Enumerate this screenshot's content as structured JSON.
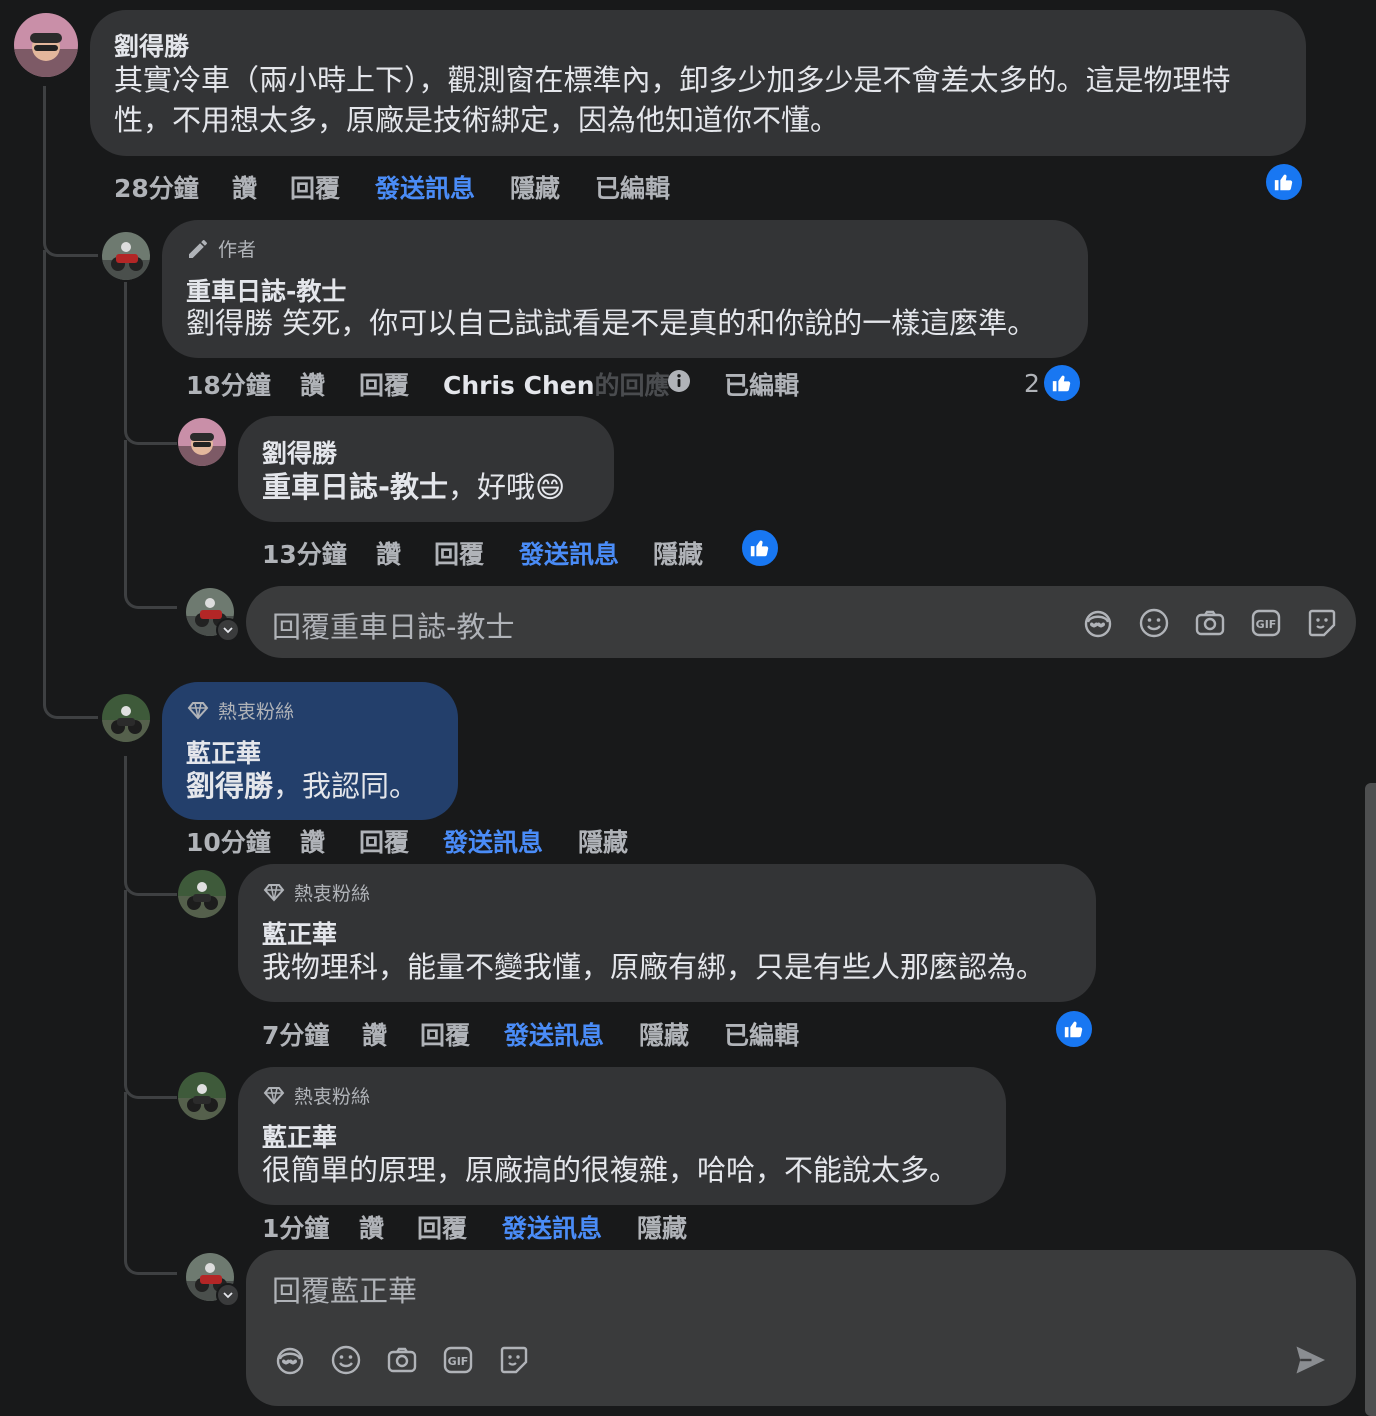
{
  "comment1": {
    "author": "劉得勝",
    "text_line1": "其實冷車（兩小時上下），觀測窗在標準內，卸多少加多少是不會差太多的。這是物理特",
    "text_line2": "性，不用想太多，原廠是技術綁定，因為他知道你不懂。",
    "time": "28分鐘",
    "like": "讚",
    "reply": "回覆",
    "send_message": "發送訊息",
    "hide": "隱藏",
    "edited": "已編輯"
  },
  "reply1": {
    "badge": "作者",
    "author": "重車日誌-教士",
    "text": "劉得勝 笑死，你可以自己試試看是不是真的和你說的一樣這麼準。",
    "time": "18分鐘",
    "like": "讚",
    "reply": "回覆",
    "reply_by": "Chris Chen",
    "reply_by_suffix": "的回應",
    "edited": "已編輯",
    "reaction_count": "2"
  },
  "reply2": {
    "author": "劉得勝",
    "mention": "重車日誌-教士",
    "text": "，好哦😄",
    "time": "13分鐘",
    "like": "讚",
    "reply": "回覆",
    "send_message": "發送訊息",
    "hide": "隱藏"
  },
  "reply_box1": {
    "placeholder": "回覆重車日誌-教士"
  },
  "comment2": {
    "badge": "熱衷粉絲",
    "author": "藍正華",
    "mention": "劉得勝",
    "text": "，我認同。",
    "time": "10分鐘",
    "like": "讚",
    "reply": "回覆",
    "send_message": "發送訊息",
    "hide": "隱藏"
  },
  "reply3": {
    "badge": "熱衷粉絲",
    "author": "藍正華",
    "text": "我物理科，能量不變我懂，原廠有綁，只是有些人那麼認為。",
    "time": "7分鐘",
    "like": "讚",
    "reply": "回覆",
    "send_message": "發送訊息",
    "hide": "隱藏",
    "edited": "已編輯"
  },
  "reply4": {
    "badge": "熱衷粉絲",
    "author": "藍正華",
    "text": "很簡單的原理，原廠搞的很複雜，哈哈，不能說太多。",
    "time": "1分鐘",
    "like": "讚",
    "reply": "回覆",
    "send_message": "發送訊息",
    "hide": "隱藏"
  },
  "reply_box2": {
    "placeholder": "回覆藍正華"
  },
  "toolbar_icons": [
    "avatar-sticker-icon",
    "emoji-icon",
    "camera-icon",
    "gif-icon",
    "sticker-icon"
  ],
  "colors": {
    "background": "#18191a",
    "bubble": "#333436",
    "highlight_bubble": "#233f6b",
    "link_blue": "#4a8cf7",
    "like_blue": "#1877f2"
  }
}
